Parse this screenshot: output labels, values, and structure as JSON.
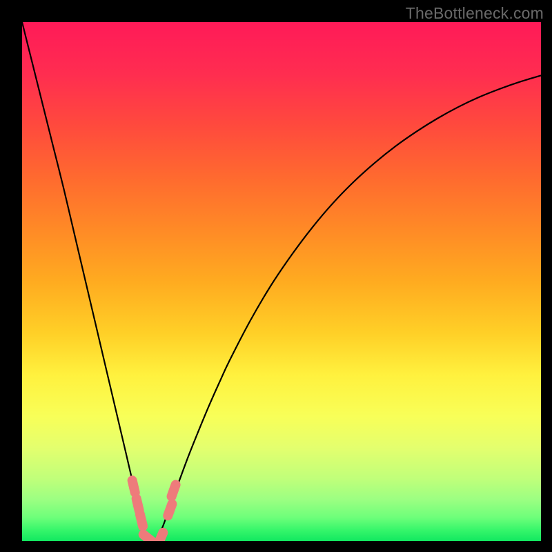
{
  "watermark": "TheBottleneck.com",
  "chart_data": {
    "type": "line",
    "title": "",
    "xlabel": "",
    "ylabel": "",
    "xlim": [
      0,
      100
    ],
    "ylim": [
      0,
      100
    ],
    "x": [
      0,
      2,
      4,
      6,
      8,
      10,
      12,
      14,
      16,
      18,
      20,
      21,
      22,
      23,
      23.5,
      24,
      24.5,
      25,
      25.5,
      26,
      27,
      28,
      29,
      30,
      32,
      34,
      36,
      38,
      40,
      44,
      48,
      52,
      56,
      60,
      64,
      68,
      72,
      76,
      80,
      84,
      88,
      92,
      96,
      100
    ],
    "values": [
      100,
      92,
      84,
      76,
      68,
      59.5,
      51,
      42.5,
      34,
      25.5,
      17,
      12.7,
      8.5,
      4.2,
      2.3,
      0.8,
      0,
      0,
      0,
      0.5,
      2.5,
      5.2,
      8.0,
      10.8,
      16.2,
      21.2,
      26.0,
      30.5,
      34.8,
      42.5,
      49.3,
      55.2,
      60.5,
      65.2,
      69.3,
      72.9,
      76.1,
      78.9,
      81.4,
      83.6,
      85.5,
      87.1,
      88.5,
      89.7
    ],
    "markers": [
      {
        "x": 21.5,
        "y": 10.5
      },
      {
        "x": 22.3,
        "y": 7.0
      },
      {
        "x": 23.0,
        "y": 4.0
      },
      {
        "x": 24.3,
        "y": 0.5
      },
      {
        "x": 26.7,
        "y": 0.5
      },
      {
        "x": 28.5,
        "y": 6.0
      },
      {
        "x": 29.2,
        "y": 9.7
      }
    ],
    "gradient_stops": [
      {
        "offset": 0.0,
        "color": "#ff1a58"
      },
      {
        "offset": 0.1,
        "color": "#ff2d50"
      },
      {
        "offset": 0.2,
        "color": "#ff4a3d"
      },
      {
        "offset": 0.3,
        "color": "#ff6a2f"
      },
      {
        "offset": 0.4,
        "color": "#ff8a26"
      },
      {
        "offset": 0.5,
        "color": "#ffab20"
      },
      {
        "offset": 0.6,
        "color": "#ffd027"
      },
      {
        "offset": 0.68,
        "color": "#fff13e"
      },
      {
        "offset": 0.76,
        "color": "#f8ff58"
      },
      {
        "offset": 0.82,
        "color": "#e4ff6e"
      },
      {
        "offset": 0.88,
        "color": "#c0ff7a"
      },
      {
        "offset": 0.92,
        "color": "#9cff82"
      },
      {
        "offset": 0.955,
        "color": "#6dff7a"
      },
      {
        "offset": 0.98,
        "color": "#34f56a"
      },
      {
        "offset": 1.0,
        "color": "#12e860"
      }
    ]
  }
}
